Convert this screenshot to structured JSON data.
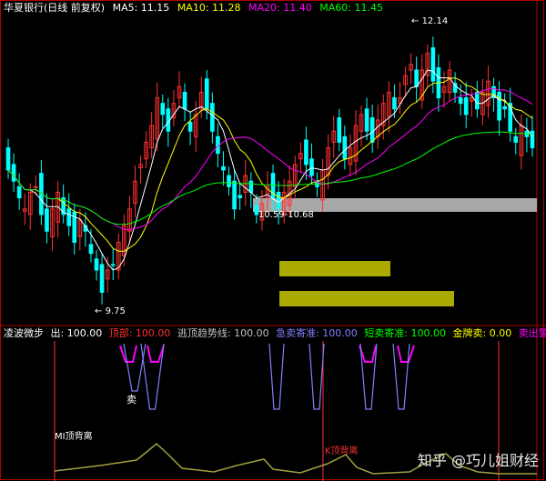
{
  "header": {
    "title": "华夏银行(日线 前复权)",
    "ma5": "MA5: 11.15",
    "ma10": "MA10: 11.28",
    "ma20": "MA20: 11.40",
    "ma60": "MA60: 11.45"
  },
  "indicator_header": {
    "name": "凌波微步",
    "out": "出: 100.00",
    "top": "顶部: 100.00",
    "escape": "逃顶趋势线: 100.00",
    "rapid": "急卖寄准: 100.00",
    "short": "短卖寄准: 100.00",
    "gold": "金牌卖: 0.00",
    "warn": "卖出警戒:"
  },
  "annotations": {
    "high": "12.14",
    "low": "9.75",
    "range": "10.59-10.68",
    "sell": "卖",
    "mi_div": "MI顶背离",
    "k_div": "K顶背离"
  },
  "watermark": "知乎 @巧儿姐财经",
  "colors": {
    "up": "#ff3030",
    "down": "#00ffff",
    "ma5": "#ffffff",
    "ma10": "#ffff00",
    "ma20": "#ff00ff",
    "ma60": "#00ff00",
    "purple": "#8080ff",
    "olive": "#a0a040"
  },
  "chart_data": {
    "type": "candlestick",
    "title": "华夏银行(日线 前复权)",
    "price_range": [
      9.6,
      12.3
    ],
    "high_label": 12.14,
    "low_label": 9.75,
    "support_band": [
      10.59,
      10.68
    ],
    "ma": {
      "MA5": 11.15,
      "MA10": 11.28,
      "MA20": 11.4,
      "MA60": 11.45
    },
    "closes": [
      10.95,
      10.85,
      10.7,
      10.6,
      10.75,
      10.8,
      10.55,
      10.4,
      10.6,
      10.75,
      10.55,
      10.45,
      10.3,
      10.5,
      10.4,
      10.2,
      10.05,
      9.85,
      10.05,
      10.1,
      10.3,
      10.45,
      10.6,
      10.85,
      11.0,
      11.2,
      11.35,
      11.6,
      11.45,
      11.3,
      11.55,
      11.7,
      11.5,
      11.3,
      11.45,
      11.65,
      11.5,
      11.3,
      11.1,
      10.95,
      10.8,
      10.6,
      10.7,
      10.9,
      10.75,
      10.55,
      10.65,
      10.8,
      10.7,
      10.6,
      10.75,
      10.85,
      11.0,
      11.1,
      11.0,
      10.9,
      10.8,
      10.95,
      11.15,
      11.3,
      11.2,
      11.05,
      11.15,
      11.35,
      11.45,
      11.3,
      11.2,
      11.4,
      11.55,
      11.65,
      11.5,
      11.6,
      11.8,
      11.9,
      11.7,
      11.85,
      12.0,
      11.75,
      11.6,
      11.7,
      11.85,
      11.65,
      11.55,
      11.45,
      11.6,
      11.5,
      11.65,
      11.75,
      11.6,
      11.4,
      11.5,
      11.3,
      11.2,
      11.35,
      11.25,
      11.15
    ]
  }
}
